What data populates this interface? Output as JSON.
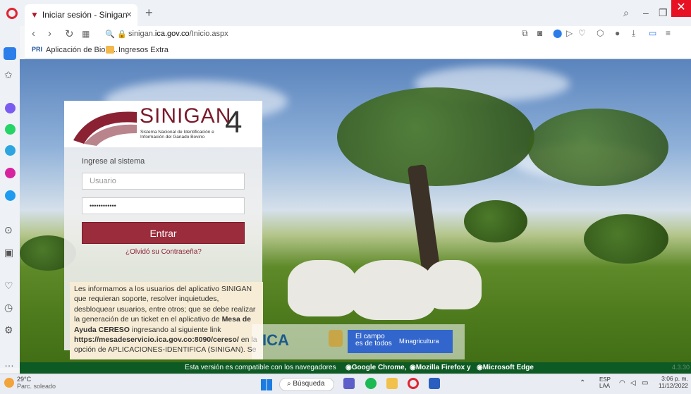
{
  "browser": {
    "tab_title": "Iniciar sesión - Sinigan",
    "close_tab": "×",
    "new_tab": "+",
    "url_prefix": "sinigan.",
    "url_domain": "ica.gov.co",
    "url_path": "/Inicio.aspx",
    "bookmarks": [
      {
        "label": "Aplicación de Bioló...",
        "icon": "bio-icon"
      },
      {
        "label": "Ingresos Extra",
        "icon": "folder-icon"
      }
    ]
  },
  "login": {
    "brand": "SINIGAN",
    "brand_number": "4",
    "subtitle": "Sistema Nacional de Identificación e Información del Ganado Bovino",
    "heading": "Ingrese al sistema",
    "user_placeholder": "Usuario",
    "password_value": "••••••••••••",
    "submit_label": "Entrar",
    "forgot_label": "¿Olvidó su Contraseña?"
  },
  "notice": {
    "p1": "Les informamos a los usuarios del aplicativo SINIGAN que requieran soporte, resolver inquietudes, desbloquear usuarios, entre otros; que se debe realizar la generación de un ticket en el aplicativo de ",
    "bold1": "Mesa de Ayuda CERESO",
    "p2": " ingresando al siguiente link ",
    "link": "https://mesadeservicio.ica.gov.co:8090/cereso/",
    "p3": " en la opción de APLICACIONES-IDENTIFICA (SINIGAN). Se"
  },
  "logos": {
    "ica": "ICA",
    "gov_line1": "El campo",
    "gov_line2": "es de todos",
    "ministry": "Minagricultura"
  },
  "footer": {
    "text": "Esta versión es compatible con los navegadores",
    "chrome": "Google Chrome,",
    "firefox": "Mozilla Firefox y",
    "edge": "Microsoft Edge",
    "version": "4.3.30"
  },
  "taskbar": {
    "temp": "29°C",
    "weather": "Parc. soleado",
    "search": "Búsqueda",
    "lang1": "ESP",
    "lang2": "LAA",
    "time": "3:06 p. m.",
    "date": "11/12/2022"
  }
}
